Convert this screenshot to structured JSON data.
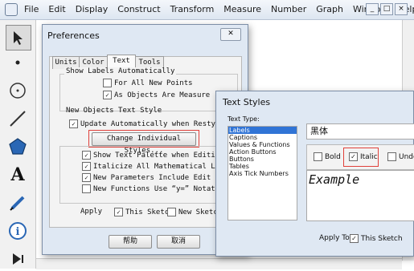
{
  "menubar": {
    "items": [
      "File",
      "Edit",
      "Display",
      "Construct",
      "Transform",
      "Measure",
      "Number",
      "Graph",
      "Window",
      "Help"
    ],
    "mdi_buttons": [
      "_",
      "□",
      "×"
    ]
  },
  "toolbox": {
    "tools": [
      "arrow-select-icon",
      "point-icon",
      "compass-icon",
      "straightedge-icon",
      "polygon-icon",
      "text-tool-icon",
      "marker-icon",
      "information-icon",
      "custom-tool-icon"
    ]
  },
  "preferences": {
    "title": "Preferences",
    "close": "✕",
    "tabs": [
      "Units",
      "Color",
      "Text",
      "Tools"
    ],
    "show_labels_heading": "Show Labels Automatically",
    "for_all_new_points": "For All New Points",
    "as_objects_are_measure": "As Objects Are Measure",
    "new_objects_heading": "New Objects Text Style",
    "update_auto": "Update Automatically when Restyling Ex",
    "change_styles_button": "Change Individual Styles...",
    "show_text_palette": "Show Text Palette when Editing Cap",
    "italicize": "Italicize All Mathematical Labels",
    "new_parameters": "New Parameters Include Edit Boxes",
    "new_functions": "New Functions Use “y=” Notat",
    "apply_label": "Apply",
    "this_sketch": "This Sketch",
    "new_sketches": "New Sketches",
    "help_button": "帮助",
    "cancel_button": "取消",
    "checks": {
      "for_all_new_points": false,
      "as_objects": true,
      "update_auto": true,
      "show_text_palette": true,
      "italicize": true,
      "new_parameters": true,
      "new_functions": false,
      "this_sketch": true,
      "new_sketches": false
    }
  },
  "text_styles": {
    "title": "Text Styles",
    "text_type_label": "Text Type:",
    "text_types": [
      "Labels",
      "Captions",
      "Values & Functions",
      "Action Buttons",
      "Buttons",
      "Tables",
      "Axis Tick Numbers"
    ],
    "selected_type": "Labels",
    "font_name": "黑体",
    "bold": "Bold",
    "italic": "Italic",
    "underline": "Unde",
    "checks": {
      "bold": false,
      "italic": true,
      "underline": false,
      "this_sketch": true
    },
    "preview": "Example",
    "apply_to": "Apply To:",
    "this_sketch": "This Sketch"
  },
  "colors": {
    "highlight": "#e0403a",
    "selection": "#3074d6"
  }
}
